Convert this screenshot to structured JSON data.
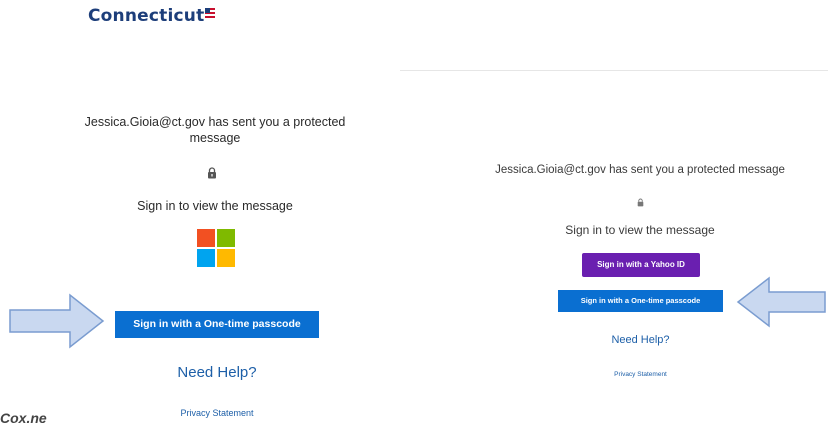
{
  "left_panel": {
    "logo_text": "Connecticut",
    "message": "Jessica.Gioia@ct.gov has sent you a protected message",
    "lock_icon": "lock-icon",
    "signin_prompt": "Sign in to view the message",
    "microsoft_logo": "microsoft-logo",
    "otp_button_label": "Sign in with a One-time passcode",
    "need_help": "Need Help?",
    "privacy": "Privacy Statement",
    "cut_off_text": "Cox.ne"
  },
  "right_panel": {
    "message": "Jessica.Gioia@ct.gov has sent you a protected message",
    "lock_icon": "lock-icon",
    "signin_prompt": "Sign in to view the message",
    "yahoo_button_label": "Sign in with a Yahoo ID",
    "otp_button_label": "Sign in with a One-time passcode",
    "need_help": "Need Help?",
    "privacy": "Privacy Statement"
  },
  "colors": {
    "brand_blue": "#0a6fd1",
    "yahoo_purple": "#6a1fb0",
    "link_blue": "#1d5fa8",
    "arrow_fill": "#c9d8f0",
    "arrow_stroke": "#7a9cd0"
  }
}
